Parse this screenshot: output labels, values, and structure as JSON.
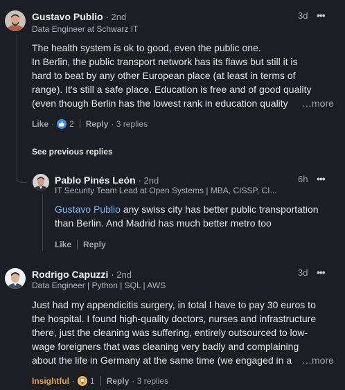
{
  "comments": [
    {
      "author": "Gustavo Publio",
      "degree": "· 2nd",
      "headline": "Data Engineer at Schwarz IT",
      "time": "3d",
      "lines": [
        "The health system is ok to good, even the public one.",
        "In Berlin, the public transport network has its flaws but still it is",
        "hard to beat by any other European place (at least in terms of",
        "range). It's still a safe place. Education is free and of good quality",
        "(even though Berlin has the lowest rank in education quality"
      ],
      "more": "…more",
      "reaction_label": "Like",
      "reaction_dot": "·",
      "reaction_count": "2",
      "reply_label": "Reply",
      "replies_count": "· 3 replies",
      "reaction_icon": "thumbs-up-icon"
    },
    {
      "author": "Pablo Pinés León",
      "degree": "· 2nd",
      "headline": "IT Security Team Lead at Open Systems | MBA, CISSP, CI...",
      "time": "6h",
      "mention": "Gustavo Publio",
      "lines_after_mention": [
        " any swiss city has better public transportation",
        "than Berlin. And Madrid has much better metro too"
      ],
      "like_label": "Like",
      "reply_label": "Reply"
    },
    {
      "author": "Rodrigo Capuzzi",
      "degree": "· 2nd",
      "headline": "Data Engineer | Python | SQL | AWS",
      "time": "3d",
      "lines": [
        "Just had my appendicitis surgery, in total I have to pay 30 euros to",
        "the hospital. I found high-quality doctors, nurses and infrastructure",
        "there, just the cleaning was suffering, entirely outsourced to low-",
        "wage foreigners that was cleaning very badly and complaining",
        "about the life in Germany at the same time (we engaged in a"
      ],
      "more": "…more",
      "reaction_label": "Insightful",
      "reaction_dot": "·",
      "reaction_count": "1",
      "reply_label": "Reply",
      "replies_count": "· 3 replies",
      "reaction_icon": "lightbulb-icon"
    }
  ],
  "see_previous": "See previous replies",
  "overflow_icon": "•••",
  "colors": {
    "background": "#1b1f23",
    "link_blue": "#71b7fb",
    "insightful": "#e7a33e"
  }
}
